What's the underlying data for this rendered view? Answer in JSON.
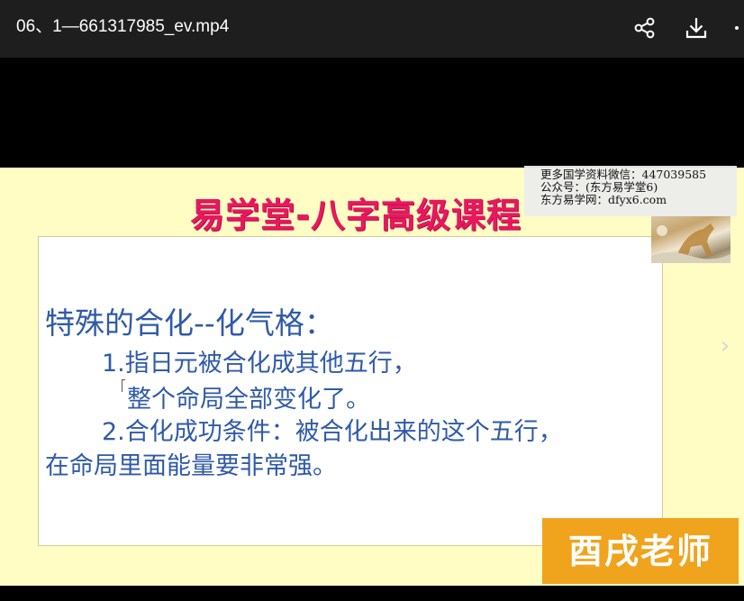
{
  "window": {
    "file_title": "06、1—661317985_ev.mp4"
  },
  "toolbar": {
    "share_icon": "share-icon",
    "download_icon": "download-icon",
    "more_icon": "more-icon"
  },
  "slide": {
    "title": "易学堂-八字高级课程",
    "heading": "特殊的合化--化气格：",
    "lines": [
      "1.指日元被合化成其他五行，",
      "整个命局全部变化了。",
      "2.合化成功条件：被合化出来的这个五行，",
      "在命局里面能量要非常强。"
    ]
  },
  "watermark": {
    "lines": [
      "更多国学资料微信：447039585",
      "公众号：(东方易学堂6)",
      "东方易学网：dfyx6.com"
    ]
  },
  "navigation": {
    "next_glyph": "›"
  },
  "badge": {
    "text": "酉戌老师"
  },
  "colors": {
    "topbar": "#1e1e1e",
    "slide_background": "#fffcc4",
    "title_pink": "#e8185e",
    "body_blue": "#2f5aa8",
    "badge_orange": "#f0a31c"
  }
}
